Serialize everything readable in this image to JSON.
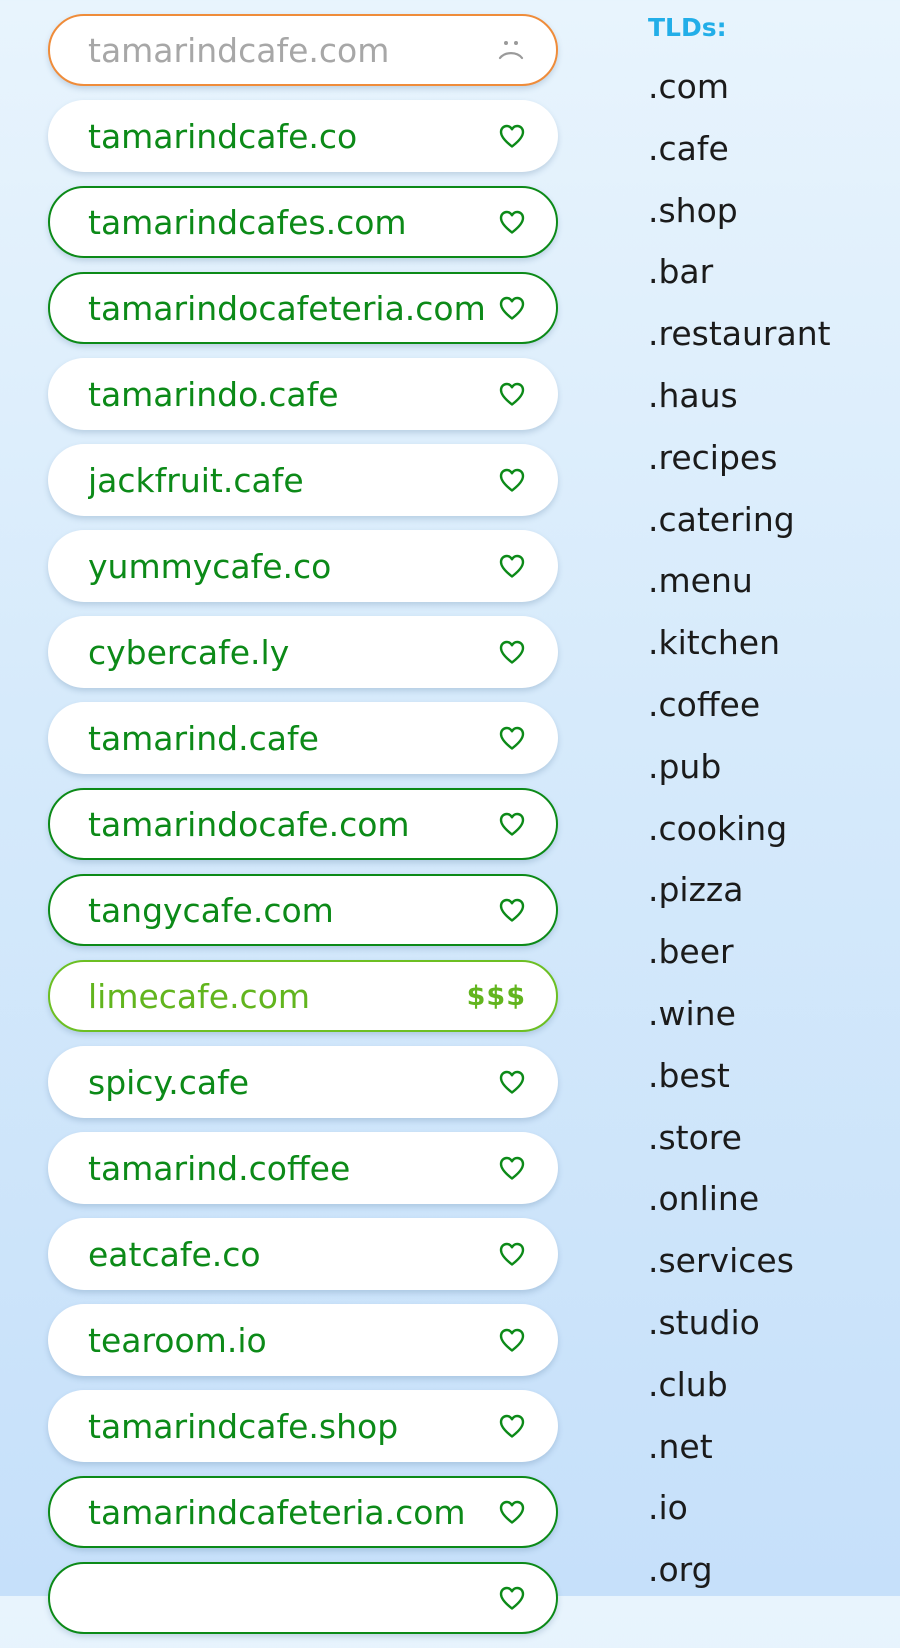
{
  "domains": [
    {
      "name": "tamarindcafe.com",
      "status": "taken",
      "outlined": false,
      "icon": "sad-face-icon"
    },
    {
      "name": "tamarindcafe.co",
      "status": "available",
      "outlined": false,
      "icon": "heart-icon"
    },
    {
      "name": "tamarindcafes.com",
      "status": "available",
      "outlined": true,
      "icon": "heart-icon"
    },
    {
      "name": "tamarindocafeteria.com",
      "status": "available",
      "outlined": true,
      "icon": "heart-icon"
    },
    {
      "name": "tamarindo.cafe",
      "status": "available",
      "outlined": false,
      "icon": "heart-icon"
    },
    {
      "name": "jackfruit.cafe",
      "status": "available",
      "outlined": false,
      "icon": "heart-icon"
    },
    {
      "name": "yummycafe.co",
      "status": "available",
      "outlined": false,
      "icon": "heart-icon"
    },
    {
      "name": "cybercafe.ly",
      "status": "available",
      "outlined": false,
      "icon": "heart-icon"
    },
    {
      "name": "tamarind.cafe",
      "status": "available",
      "outlined": false,
      "icon": "heart-icon"
    },
    {
      "name": "tamarindocafe.com",
      "status": "available",
      "outlined": true,
      "icon": "heart-icon"
    },
    {
      "name": "tangycafe.com",
      "status": "available",
      "outlined": true,
      "icon": "heart-icon"
    },
    {
      "name": "limecafe.com",
      "status": "premium",
      "outlined": false,
      "icon": "price-icon",
      "price_label": "$$$"
    },
    {
      "name": "spicy.cafe",
      "status": "available",
      "outlined": false,
      "icon": "heart-icon"
    },
    {
      "name": "tamarind.coffee",
      "status": "available",
      "outlined": false,
      "icon": "heart-icon"
    },
    {
      "name": "eatcafe.co",
      "status": "available",
      "outlined": false,
      "icon": "heart-icon"
    },
    {
      "name": "tearoom.io",
      "status": "available",
      "outlined": false,
      "icon": "heart-icon"
    },
    {
      "name": "tamarindcafe.shop",
      "status": "available",
      "outlined": false,
      "icon": "heart-icon"
    },
    {
      "name": "tamarindcafeteria.com",
      "status": "available",
      "outlined": true,
      "icon": "heart-icon"
    },
    {
      "name": "",
      "status": "available",
      "outlined": true,
      "icon": "heart-icon"
    }
  ],
  "tld_panel": {
    "heading": "TLDs:",
    "items": [
      ".com",
      ".cafe",
      ".shop",
      ".bar",
      ".restaurant",
      ".haus",
      ".recipes",
      ".catering",
      ".menu",
      ".kitchen",
      ".coffee",
      ".pub",
      ".cooking",
      ".pizza",
      ".beer",
      ".wine",
      ".best",
      ".store",
      ".online",
      ".services",
      ".studio",
      ".club",
      ".net",
      ".io",
      ".org"
    ]
  },
  "colors": {
    "available": "#0c8a18",
    "taken_text": "#a7a7a7",
    "taken_border": "#ef8c3a",
    "premium": "#62b51e",
    "tld_heading": "#22aee8",
    "tld_text": "#1b1b1b",
    "background_top": "#e8f4fd",
    "background_bottom": "#c6e0fa"
  }
}
